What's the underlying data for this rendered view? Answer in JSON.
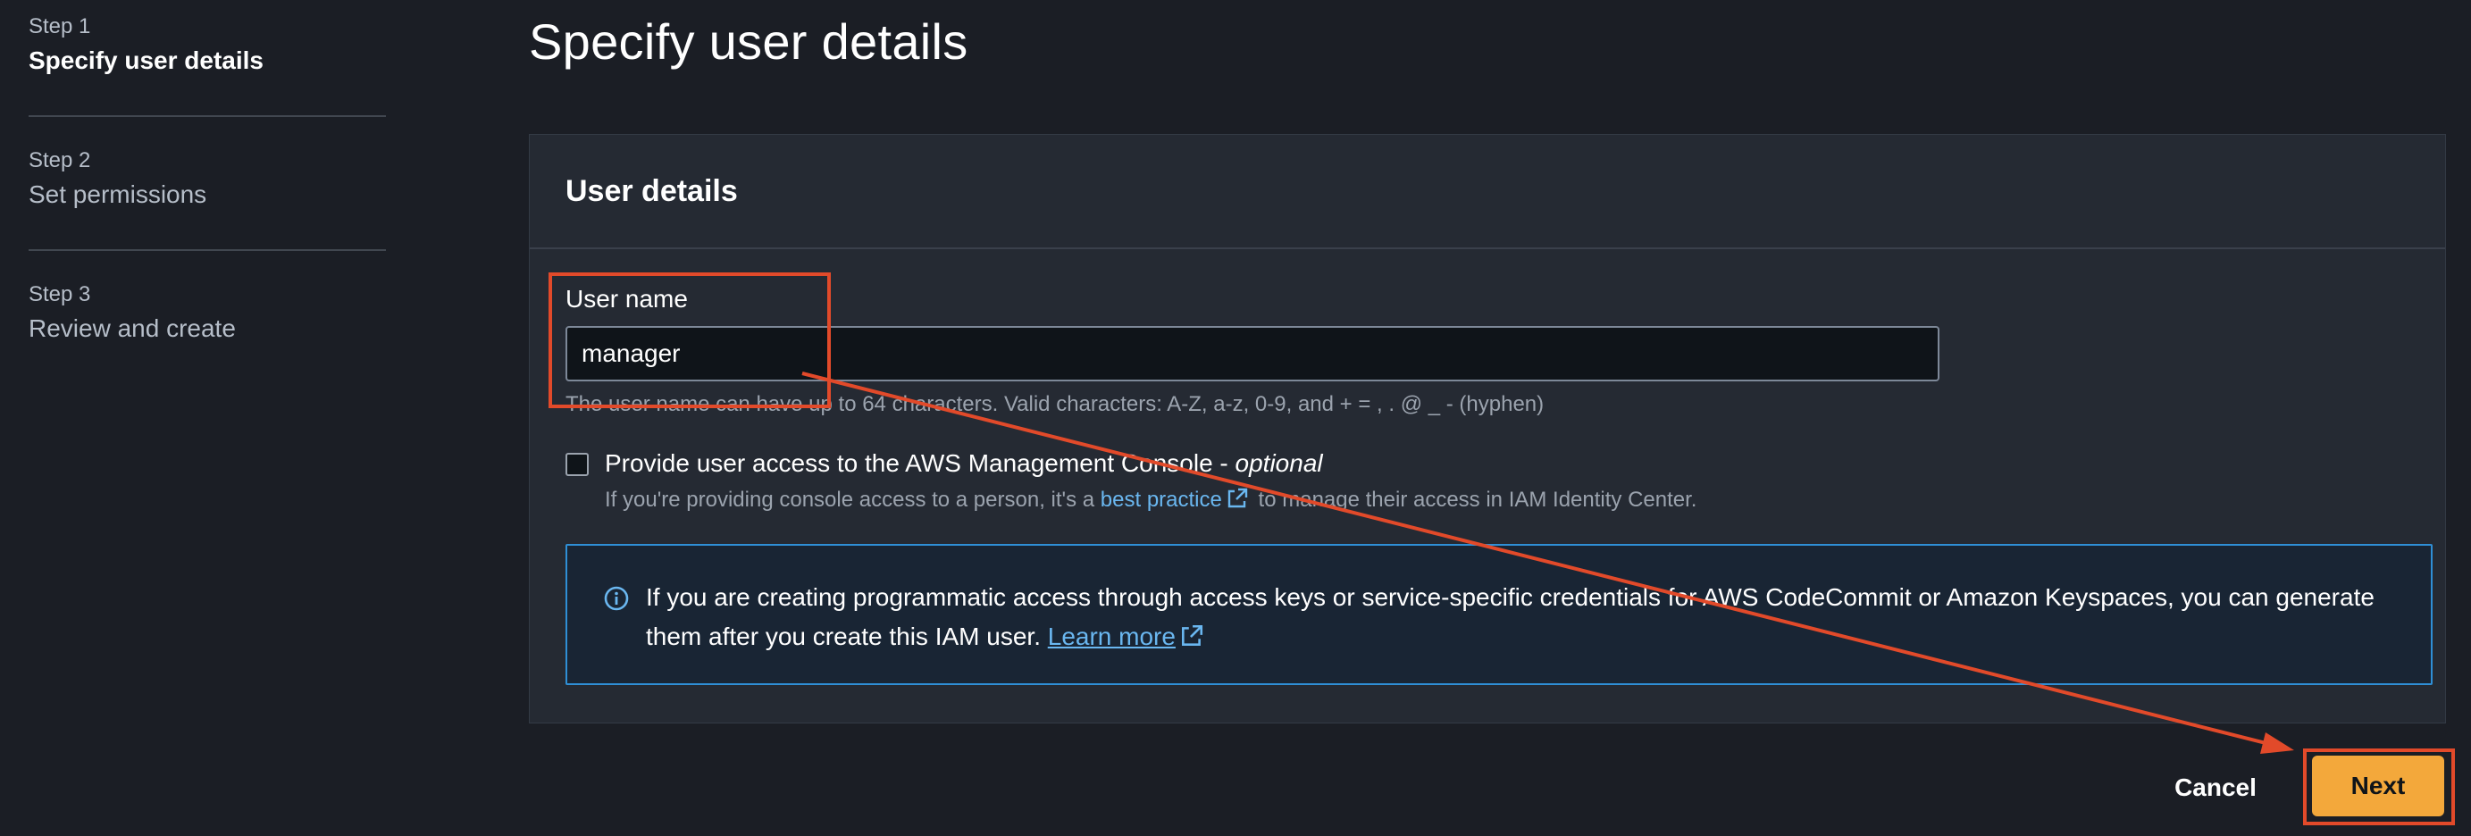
{
  "steps": [
    {
      "number": "Step 1",
      "title": "Specify user details",
      "active": true
    },
    {
      "number": "Step 2",
      "title": "Set permissions",
      "active": false
    },
    {
      "number": "Step 3",
      "title": "Review and create",
      "active": false
    }
  ],
  "page_title": "Specify user details",
  "panel": {
    "header": "User details",
    "user_name_label": "User name",
    "user_name_value": "manager",
    "user_name_constraint": "The user name can have up to 64 characters. Valid characters: A-Z, a-z, 0-9, and + = , . @ _ - (hyphen)",
    "console_access": {
      "checked": false,
      "label": "Provide user access to the AWS Management Console - ",
      "label_optional": "optional",
      "desc_before": "If you're providing console access to a person, it's a ",
      "desc_link": "best practice",
      "desc_after": " to manage their access in IAM Identity Center."
    },
    "info": {
      "text": "If you are creating programmatic access through access keys or service-specific credentials for AWS CodeCommit or Amazon Keyspaces, you can generate them after you create this IAM user. ",
      "link": "Learn more"
    }
  },
  "footer": {
    "cancel_label": "Cancel",
    "next_label": "Next"
  },
  "colors": {
    "background": "#1b1e25",
    "panel": "#252a33",
    "primary_button": "#f3a83b",
    "link": "#6ab7f0",
    "info_border": "#2f8fd6",
    "annotation": "#e24a2a"
  },
  "icons": [
    "external-link-icon",
    "info-icon",
    "checkbox"
  ]
}
